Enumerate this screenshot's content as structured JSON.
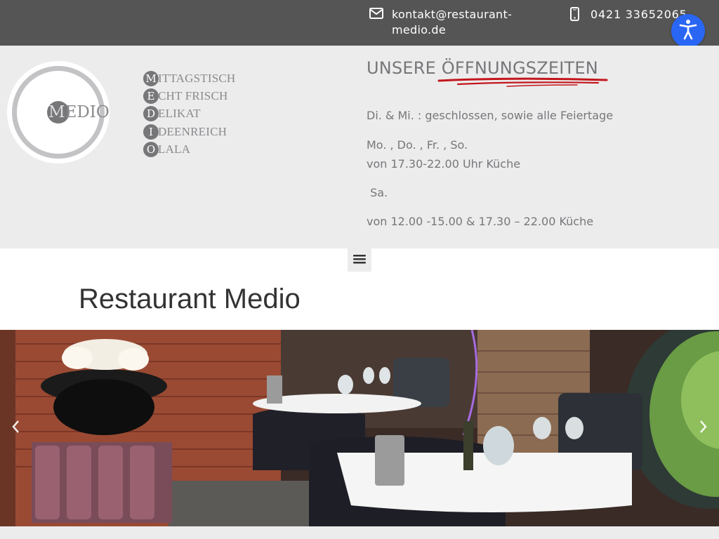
{
  "topbar": {
    "email": "kontakt@restaurant-medio.de",
    "phone": "0421 33652065",
    "email_icon": "envelope-icon",
    "phone_icon": "mobile-phone-icon"
  },
  "accessibility": {
    "icon": "accessibility-person-icon",
    "color": "#2a66f4"
  },
  "logo": {
    "initial": "M",
    "rest": "EDIO"
  },
  "acrostic": [
    {
      "letter": "M",
      "word": "ITTAGSTISCH"
    },
    {
      "letter": "E",
      "word": "CHT FRISCH"
    },
    {
      "letter": "D",
      "word": "ELIKAT"
    },
    {
      "letter": "I",
      "word": "DEENREICH"
    },
    {
      "letter": "O",
      "word": "LALA"
    }
  ],
  "hours": {
    "title": "UNSERE ÖFFNUNGSZEITEN",
    "closed": "Di. & Mi. : geschlossen, sowie alle Feiertage",
    "days1": "Mo. , Do. , Fr. , So.",
    "days1_time": "von 17.30-22.00 Uhr Küche",
    "days2": " Sa.",
    "days2_time": "von 12.00 -15.00 & 17.30 – 22.00 Küche",
    "underline_color": "#c3161c"
  },
  "menu": {
    "icon": "hamburger-menu-icon"
  },
  "page": {
    "title": "Restaurant Medio"
  },
  "slider": {
    "prev_icon": "chevron-left-icon",
    "next_icon": "chevron-right-icon"
  },
  "colors": {
    "topbar": "#555555",
    "header_bg": "#ececed",
    "text_grey": "#77777a"
  }
}
